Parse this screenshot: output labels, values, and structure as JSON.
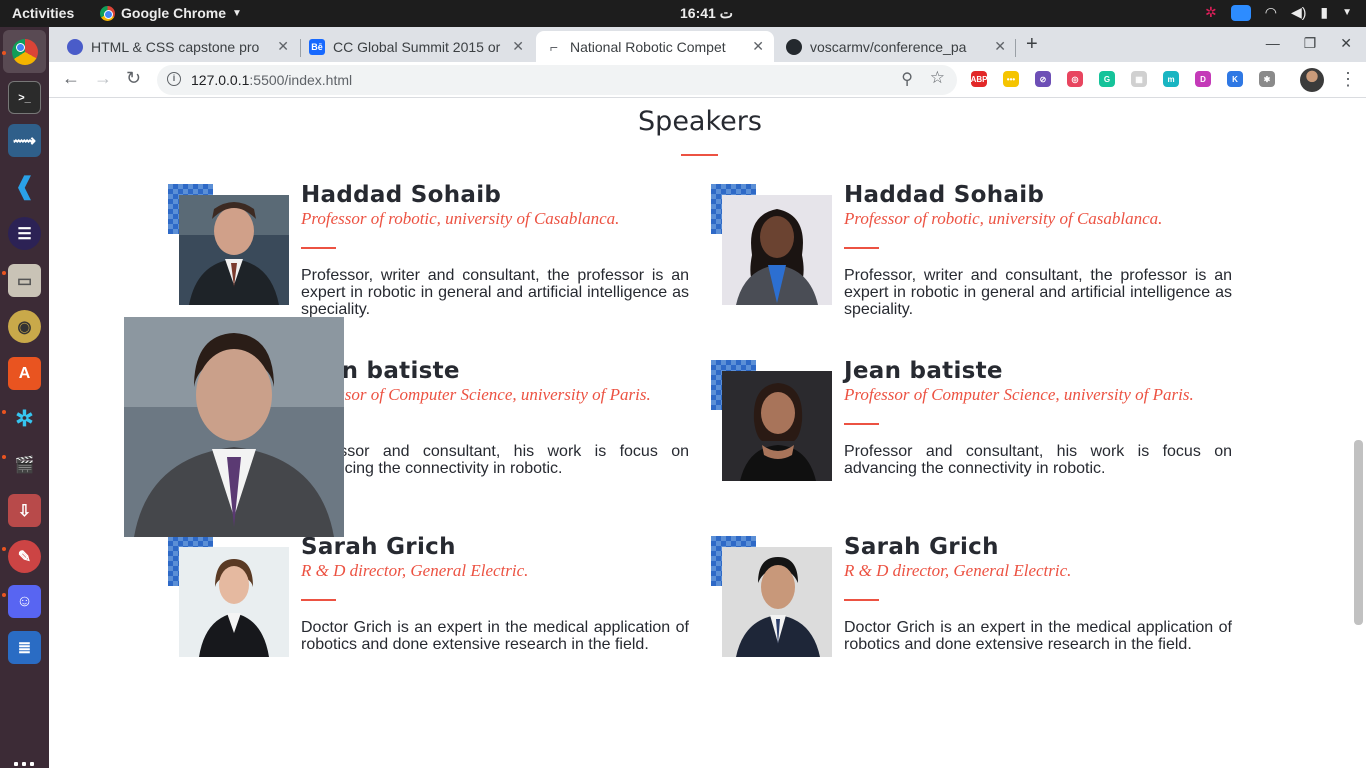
{
  "topbar": {
    "activities": "Activities",
    "app_name": "Google Chrome",
    "clock": "16:41 ت"
  },
  "tabs": [
    {
      "title": "HTML & CSS capstone pro",
      "favicon": "chat-bubble-icon",
      "color": "#4a5cc9"
    },
    {
      "title": "CC Global Summit 2015 or",
      "favicon": "behance-icon",
      "color": "#1769ff"
    },
    {
      "title": "National Robotic Compet",
      "favicon": "robot-arm-icon",
      "color": "#5f6368",
      "active": true
    },
    {
      "title": "voscarmv/conference_pa",
      "favicon": "github-icon",
      "color": "#24292e"
    }
  ],
  "toolbar": {
    "url_host": "127.0.0.1",
    "url_path": ":5500/index.html",
    "info_glyph": "i"
  },
  "extensions": [
    {
      "name": "adblock-plus-icon",
      "label": "ABP",
      "color": "#e22828"
    },
    {
      "name": "note-extension-icon",
      "label": "•••",
      "color": "#f5c400"
    },
    {
      "name": "blocker-extension-icon",
      "label": "⊘",
      "color": "#6d4fb6"
    },
    {
      "name": "multi-link-extension-icon",
      "label": "◎",
      "color": "#e8455f"
    },
    {
      "name": "grammarly-icon",
      "label": "G",
      "color": "#15c39a"
    },
    {
      "name": "grid-extension-icon",
      "label": "▦",
      "color": "#d0d0d0"
    },
    {
      "name": "m-extension-icon",
      "label": "m",
      "color": "#19b5c2"
    },
    {
      "name": "d-extension-icon",
      "label": "D",
      "color": "#c43ab8"
    },
    {
      "name": "k-extension-icon",
      "label": "K",
      "color": "#2f78e4"
    },
    {
      "name": "bug-extension-icon",
      "label": "✱",
      "color": "#8a8a8a"
    }
  ],
  "page": {
    "section_title": "Speakers",
    "accent_color": "#ec5242",
    "speakers": [
      {
        "name": "Haddad Sohaib",
        "role": "Professor of robotic, university of Casablanca.",
        "bio": "Professor, writer and consultant, the professor is an expert in robotic in general and artificial intelligence as speciality."
      },
      {
        "name": "Haddad Sohaib",
        "role": "Professor of robotic, university of Casablanca.",
        "bio": "Professor, writer and consultant, the professor is an expert in robotic in general and artificial intelligence as speciality."
      },
      {
        "name": "Jean batiste",
        "role": "Professor of Computer Science, university of Paris.",
        "bio": "Professor and consultant, his work is focus on advancing the connectivity in robotic."
      },
      {
        "name": "Jean batiste",
        "role": "Professor of Computer Science, university of Paris.",
        "bio": "Professor and consultant, his work is focus on advancing the connectivity in robotic."
      },
      {
        "name": "Sarah Grich",
        "role": "R & D director, General Electric.",
        "bio": "Doctor Grich is an expert in the medical application of robotics and done extensive research in the field."
      },
      {
        "name": "Sarah Grich",
        "role": "R & D director, General Electric.",
        "bio": "Doctor Grich is an expert in the medical application of robotics and done extensive research in the field."
      }
    ]
  }
}
